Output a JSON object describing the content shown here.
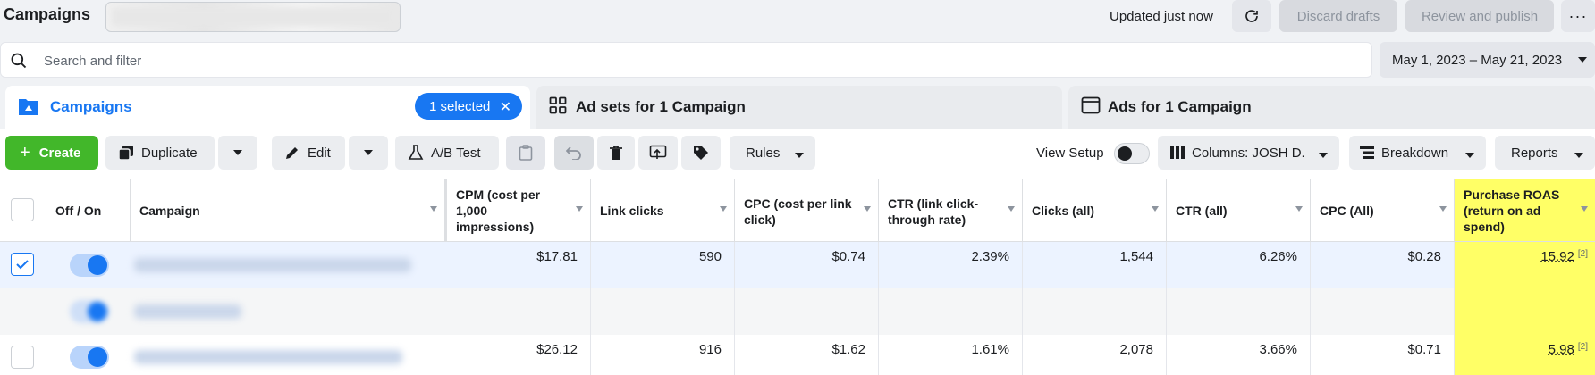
{
  "header": {
    "title": "Campaigns",
    "updated": "Updated just now",
    "discard_label": "Discard drafts",
    "publish_label": "Review and publish",
    "more_label": "···"
  },
  "search": {
    "placeholder": "Search and filter",
    "value": ""
  },
  "date_range": "May 1, 2023 – May 21, 2023",
  "tabs": [
    {
      "label": "Campaigns",
      "badge": "1 selected"
    },
    {
      "label": "Ad sets for 1 Campaign"
    },
    {
      "label": "Ads for 1 Campaign"
    }
  ],
  "toolbar": {
    "create": "Create",
    "duplicate": "Duplicate",
    "edit": "Edit",
    "ab_test": "A/B Test",
    "rules": "Rules",
    "view_setup": "View Setup",
    "columns": "Columns: JOSH D.",
    "breakdown": "Breakdown",
    "reports": "Reports"
  },
  "table": {
    "headers": {
      "off_on": "Off / On",
      "campaign": "Campaign",
      "cpm": "CPM (cost per 1,000 impressions)",
      "link_clicks": "Link clicks",
      "cpc_link": "CPC (cost per link click)",
      "ctr_link": "CTR (link click-through rate)",
      "clicks_all": "Clicks (all)",
      "ctr_all": "CTR (all)",
      "cpc_all": "CPC (All)",
      "roas": "Purchase ROAS (return on ad spend)"
    },
    "rows": [
      {
        "selected": true,
        "cpm": "$17.81",
        "link_clicks": "590",
        "cpc_link": "$0.74",
        "ctr_link": "2.39%",
        "clicks_all": "1,544",
        "ctr_all": "6.26%",
        "cpc_all": "$0.28",
        "roas": "15.92",
        "roas_note": "[2]"
      },
      {
        "selected": false,
        "cpm": "",
        "link_clicks": "",
        "cpc_link": "",
        "ctr_link": "",
        "clicks_all": "",
        "ctr_all": "",
        "cpc_all": "",
        "roas": "",
        "roas_note": ""
      },
      {
        "selected": false,
        "cpm": "$26.12",
        "link_clicks": "916",
        "cpc_link": "$1.62",
        "ctr_link": "1.61%",
        "clicks_all": "2,078",
        "ctr_all": "3.66%",
        "cpc_all": "$0.71",
        "roas": "5.98",
        "roas_note": "[2]"
      }
    ]
  },
  "colors": {
    "accent": "#1877f2",
    "create": "#42b72a",
    "highlight": "#ffff66"
  }
}
